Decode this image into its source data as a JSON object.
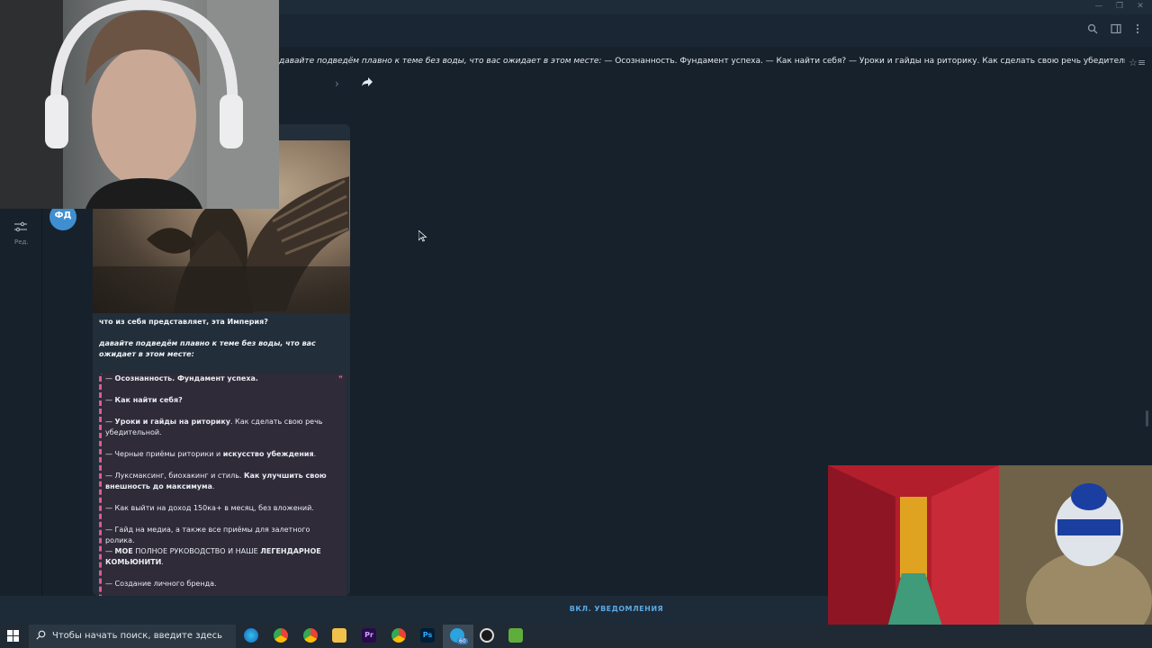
{
  "window": {
    "minimize": "—",
    "restore": "❐",
    "close": "✕"
  },
  "header_icons": [
    "search-icon",
    "sidebar-toggle-icon",
    "more-icon"
  ],
  "pinned": {
    "prefix_italic": "давайте подведём плавно к теме без воды, что вас ожидает в этом месте:",
    "rest": " — Осознанность. Фундамент успеха.  — Как найти себя?  — Уроки и гайды на риторику. Как сделать свою речь убедительной.  — Черные приёмы р..."
  },
  "sidebar": {
    "edit_label": "Ред."
  },
  "avatar": {
    "initials": "ФД",
    "color": "#3f8fd0"
  },
  "post": {
    "line1": "что из себя представляет, эта Империя?",
    "line2": "давайте подведём плавно к теме без воды, что вас ожидает в этом месте:",
    "quote": [
      {
        "pre": "— ",
        "bold": "Осознанность. Фундамент успеха.",
        "post": ""
      },
      {
        "pre": "— ",
        "bold": "Как найти себя?",
        "post": ""
      },
      {
        "pre": "— ",
        "bold": "Уроки и гайды на риторику",
        "post": ". Как сделать свою речь убедительной."
      },
      {
        "pre": "— Черные приёмы риторики и ",
        "bold": "искусство убеждения",
        "post": "."
      },
      {
        "pre": "— Луксмаксинг, биохакинг и стиль. ",
        "bold": "Как улучшить свою внешность до максимума",
        "post": "."
      },
      {
        "pre": "— Как выйти на доход 150ка+ в месяц, без вложений.",
        "bold": "",
        "post": ""
      },
      {
        "pre": "— Гайд на медиа, а также все приёмы для залетного ролика.",
        "bold": "",
        "post": ""
      },
      {
        "pre": "— ",
        "bold": "МОЕ",
        "post": " ПОЛНОЕ РУКОВОДСТВО И НАШЕ ",
        "bold2": "ЛЕГЕНДАРНОЕ КОМЬЮНИТИ",
        "post2": "."
      },
      {
        "pre": "— Создание личного бренда.",
        "bold": "",
        "post": ""
      }
    ]
  },
  "bottom": {
    "notify_label": "ВКЛ. УВЕДОМЛЕНИЯ"
  },
  "taskbar": {
    "search_placeholder": "Чтобы начать поиск, введите здесь",
    "apps": [
      "edge-icon",
      "chrome-icon",
      "chrome-icon",
      "folder-icon",
      "premiere-icon",
      "chrome-icon",
      "photoshop-icon",
      "telegram-icon",
      "obs-icon",
      "minecraft-icon"
    ],
    "telegram_badge": "60"
  },
  "colors": {
    "background": "#17212b",
    "accent": "#5aa9e6",
    "quote_bar": "#e05a8f"
  }
}
